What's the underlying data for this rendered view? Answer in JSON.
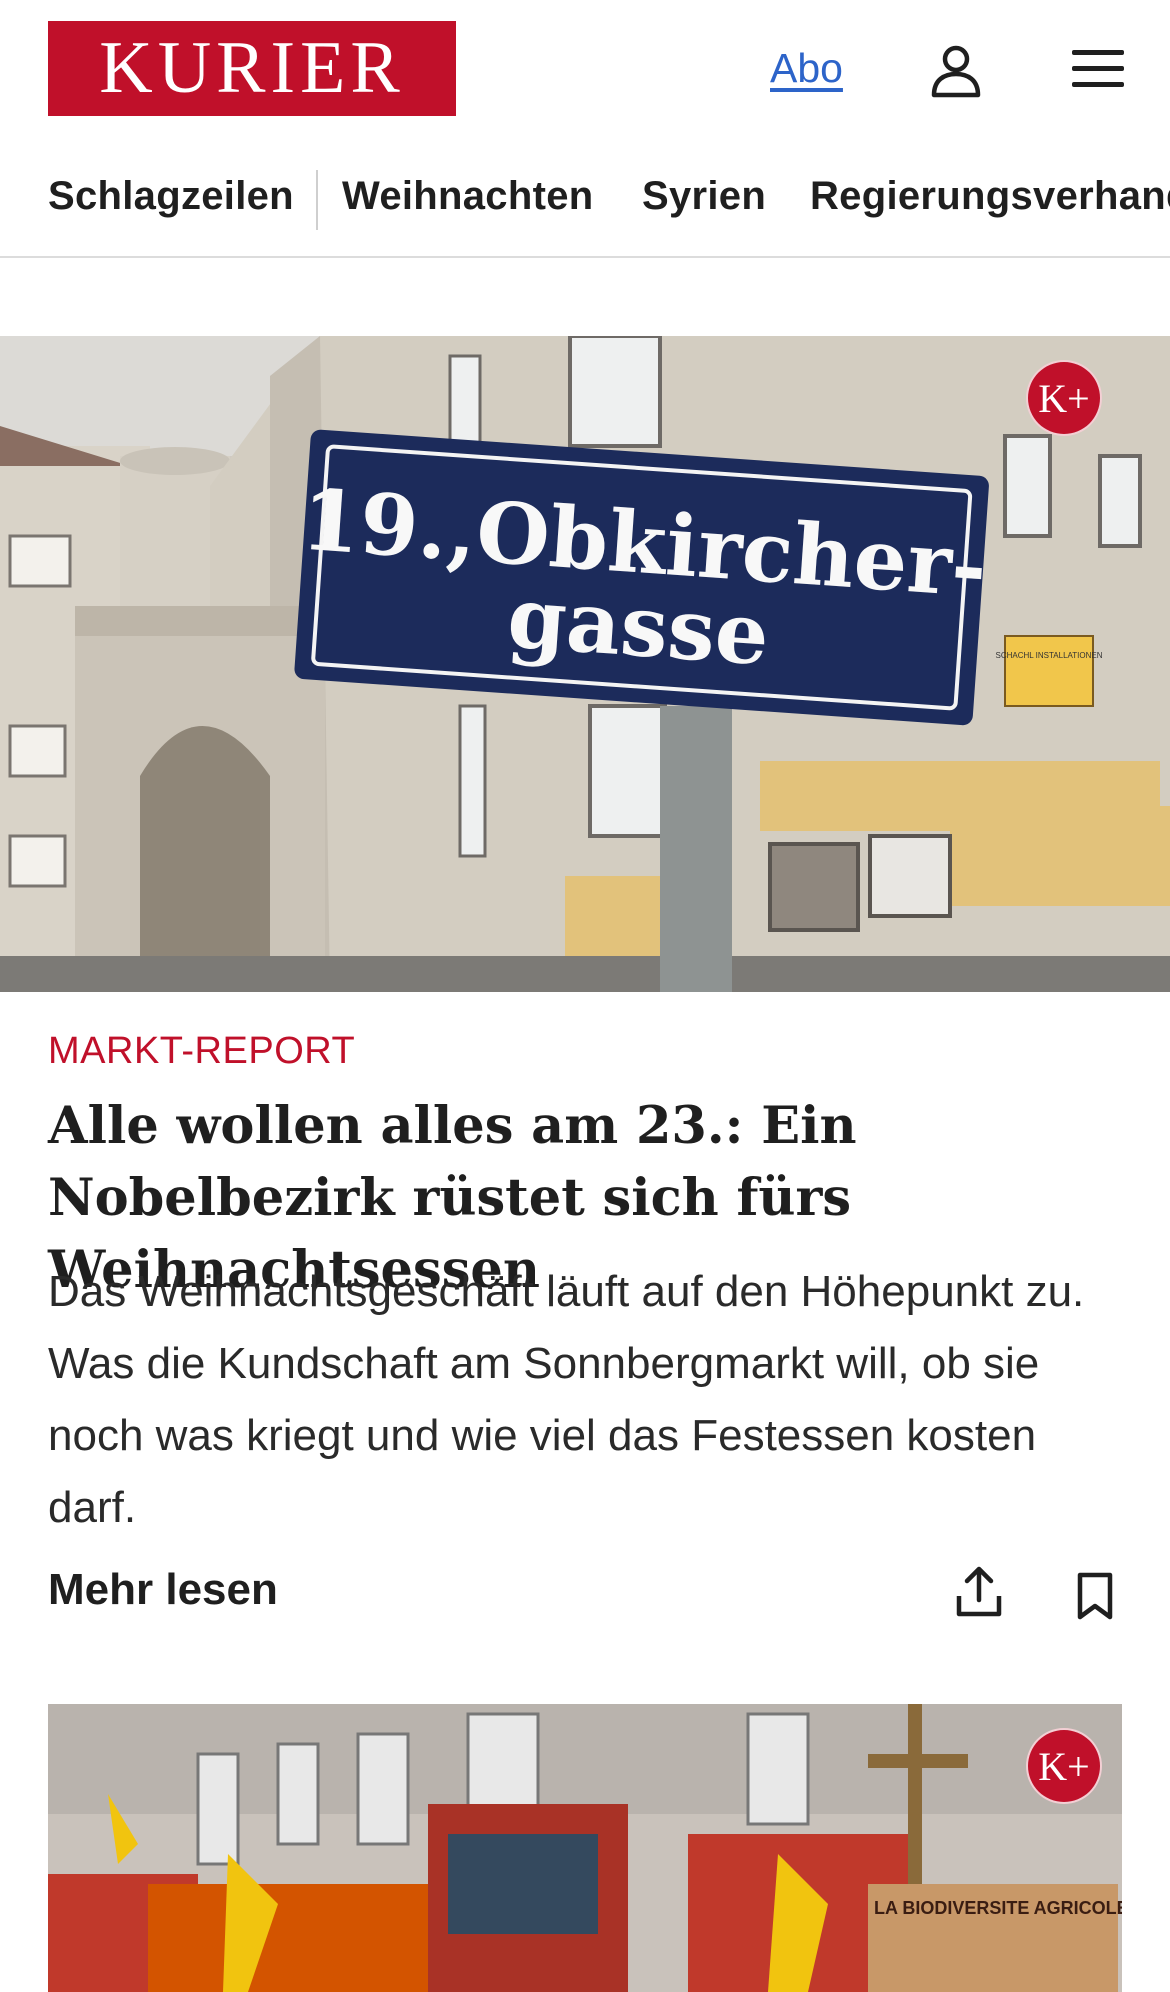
{
  "header": {
    "logo_text": "KURIER",
    "abo_label": "Abo",
    "user_icon": "user-icon",
    "menu_icon": "hamburger-menu-icon"
  },
  "nav": {
    "items": [
      {
        "label": "Schlagzeilen"
      },
      {
        "label": "Weihnachten"
      },
      {
        "label": "Syrien"
      },
      {
        "label": "Regierungsverhandlungen"
      }
    ]
  },
  "articles": [
    {
      "image_sign_line1": "19.,Obkircher-",
      "image_sign_line2": "gasse",
      "image_shop_sign": "SCHACHL INSTALLATIONEN",
      "premium_badge": "K+",
      "kicker": "MARKT-REPORT",
      "headline": "Alle wollen alles am 23.: Ein Nobelbezirk rüstet sich fürs Weihnachtsessen",
      "teaser": "Das Weihnachtsgeschäft läuft auf den Höhepunkt zu. Was die Kundschaft am Sonnbergmarkt will, ob sie noch was kriegt und wie viel das Festessen kosten darf.",
      "more_label": "Mehr lesen",
      "share_icon": "share-icon",
      "bookmark_icon": "bookmark-icon"
    },
    {
      "premium_badge": "K+",
      "image_banner_text": "LA BIODIVERSITE AGRICOLE"
    }
  ],
  "colors": {
    "brand": "#c0102a",
    "link": "#2d64c9",
    "text": "#1f1f1f"
  }
}
